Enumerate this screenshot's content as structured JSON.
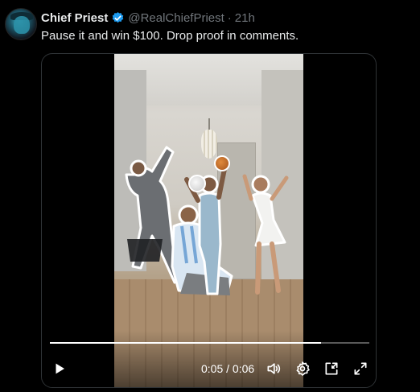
{
  "post": {
    "author_name": "Chief Priest",
    "handle": "@RealChiefPriest",
    "separator": "·",
    "time": "21h",
    "text": "Pause it and win $100. Drop proof in comments."
  },
  "video": {
    "current_time": "0:05",
    "time_separator": " / ",
    "duration": "0:06",
    "progress_fraction": 0.85
  },
  "icons": {
    "verified": "verified-badge-icon",
    "play": "play-icon",
    "volume": "volume-icon",
    "settings": "gear-icon",
    "pip": "picture-in-picture-icon",
    "fullscreen": "fullscreen-icon"
  },
  "colors": {
    "background": "#000000",
    "text_primary": "#e7e9ea",
    "text_secondary": "#71767b",
    "verified_blue": "#1d9bf0"
  }
}
